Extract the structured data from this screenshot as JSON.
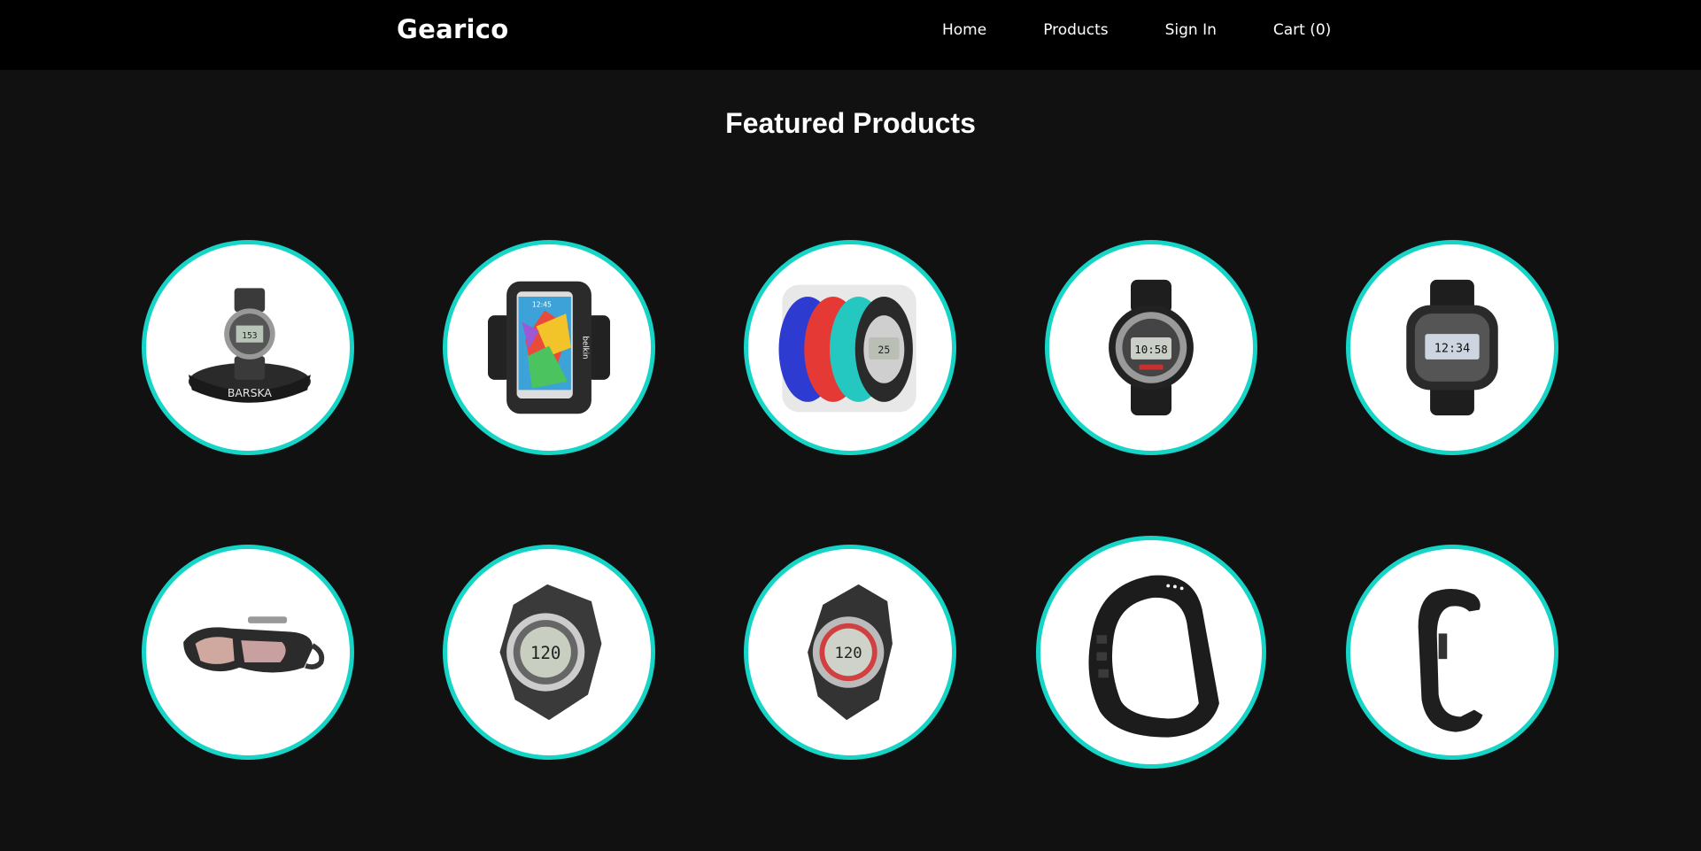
{
  "header": {
    "brand": "Gearico",
    "nav": [
      {
        "label": "Home"
      },
      {
        "label": "Products"
      },
      {
        "label": "Sign In"
      },
      {
        "label": "Cart (0)"
      }
    ]
  },
  "main": {
    "title": "Featured Products",
    "products": [
      {
        "icon": "barska-watch-icon",
        "logo_text": "BARSKA",
        "display_text": "153"
      },
      {
        "icon": "phone-armband-icon",
        "logo_text": "belkin",
        "display_text": "12:45"
      },
      {
        "icon": "color-watches-icon",
        "display_text": "25"
      },
      {
        "icon": "g-shock-watch-icon",
        "display_text": "10:58"
      },
      {
        "icon": "casio-tough-solar-watch-icon",
        "display_text": "12:34"
      },
      {
        "icon": "smart-goggles-icon"
      },
      {
        "icon": "heart-rate-watch-icon",
        "display_text": "120"
      },
      {
        "icon": "heart-rate-watch-red-icon",
        "display_text": "120"
      },
      {
        "icon": "fitness-band-icon"
      },
      {
        "icon": "cuff-band-icon"
      }
    ]
  },
  "colors": {
    "accent": "#16d4c6",
    "navbar_bg": "#000000",
    "page_bg": "#111111"
  }
}
